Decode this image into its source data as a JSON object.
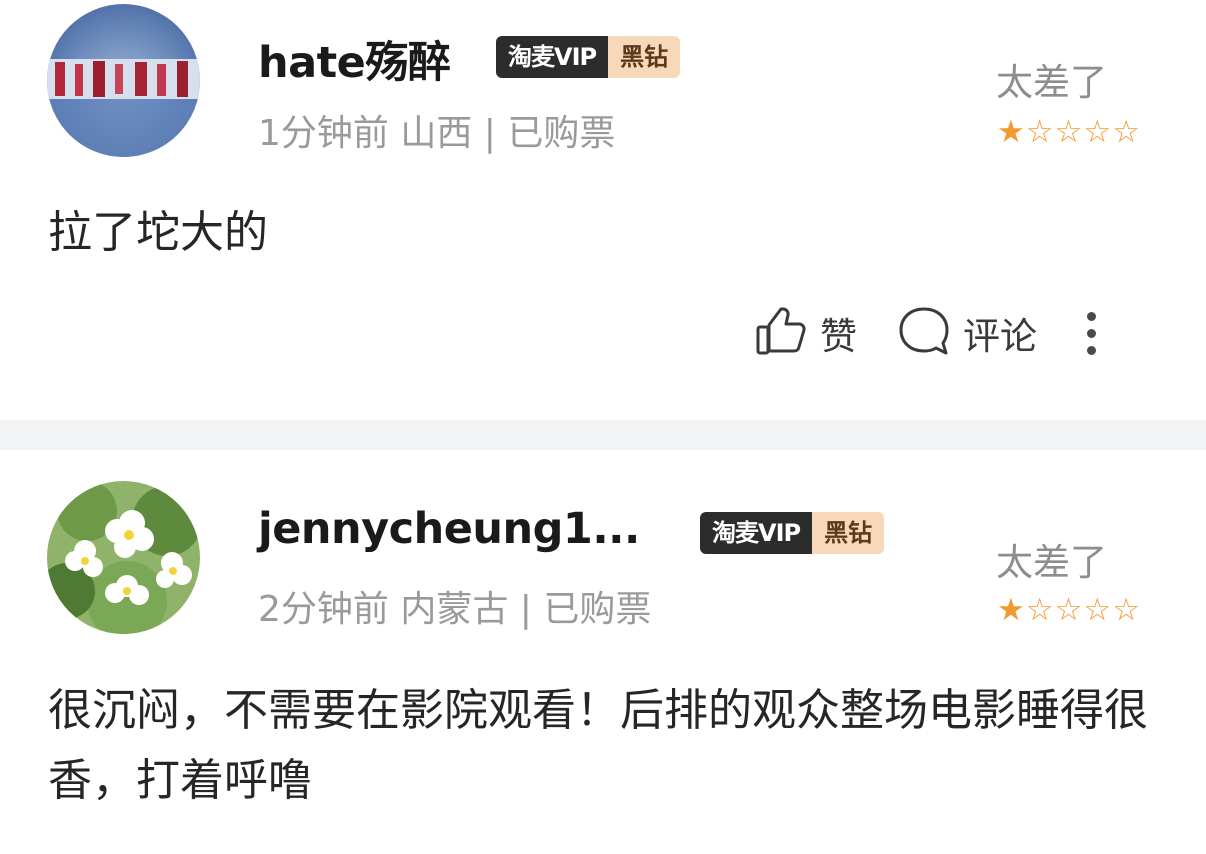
{
  "reviews": [
    {
      "username": "hate殇醉",
      "badge_vip": "淘麦VIP",
      "badge_level": "黑钻",
      "meta": "1分钟前 山西 | 已购票",
      "rating_text": "太差了",
      "rating": 1,
      "content": "拉了坨大的",
      "avatar_colors": [
        "#4b6ea8",
        "#c1d0e6",
        "#b02030"
      ]
    },
    {
      "username": "jennycheung1...",
      "badge_vip": "淘麦VIP",
      "badge_level": "黑钻",
      "meta": "2分钟前 内蒙古 | 已购票",
      "rating_text": "太差了",
      "rating": 1,
      "content": "很沉闷，不需要在影院观看！后排的观众整场电影睡得很香，打着呼噜",
      "avatar_colors": [
        "#5f8f42",
        "#ffffff",
        "#f4d33a"
      ]
    }
  ],
  "actions": {
    "like_label": "赞",
    "comment_label": "评论"
  },
  "icons": {
    "like": "thumbs-up-icon",
    "comment": "comment-bubble-icon",
    "more": "more-vertical-icon"
  },
  "colors": {
    "star": "#f39a2f",
    "badge_dark": "#2c2c2c",
    "badge_gold": "#f7d9b9",
    "divider": "#f2f3f5"
  }
}
